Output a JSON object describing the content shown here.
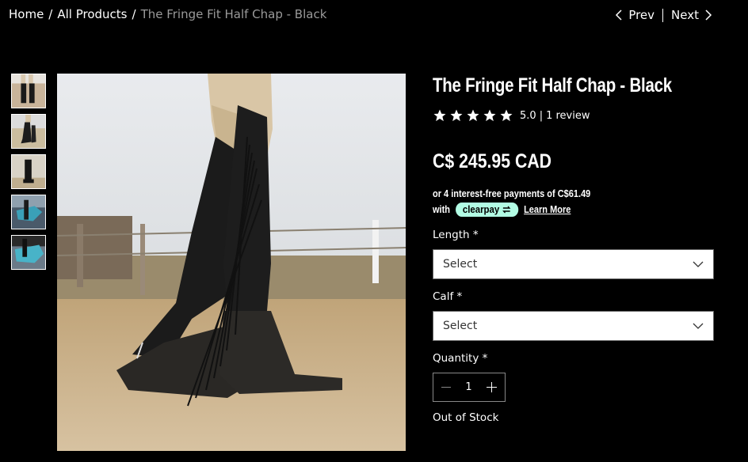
{
  "breadcrumb": {
    "home": "Home",
    "all_products": "All Products",
    "current": "The Fringe Fit Half Chap - Black",
    "separator": "/"
  },
  "pager": {
    "prev": "Prev",
    "next": "Next"
  },
  "thumbnails": [
    "thumbnail-1",
    "thumbnail-2",
    "thumbnail-3",
    "thumbnail-4",
    "thumbnail-5"
  ],
  "product": {
    "title": "The Fringe Fit Half Chap - Black",
    "rating": {
      "stars": 5,
      "value": "5.0",
      "separator": "|",
      "reviews": "1 review"
    },
    "price": "C$ 245.95 CAD",
    "installments": {
      "line1": "or 4 interest-free payments of C$61.49",
      "with": "with",
      "brand": "clearpay",
      "learn_more": "Learn More"
    },
    "options": {
      "length_label": "Length *",
      "length_value": "Select",
      "calf_label": "Calf *",
      "calf_value": "Select"
    },
    "quantity_label": "Quantity *",
    "quantity_value": "1",
    "stock_status": "Out of Stock"
  },
  "colors": {
    "background": "#000000",
    "clearpay_badge": "#b2fce4",
    "breadcrumb_current": "#9a9a9a"
  }
}
